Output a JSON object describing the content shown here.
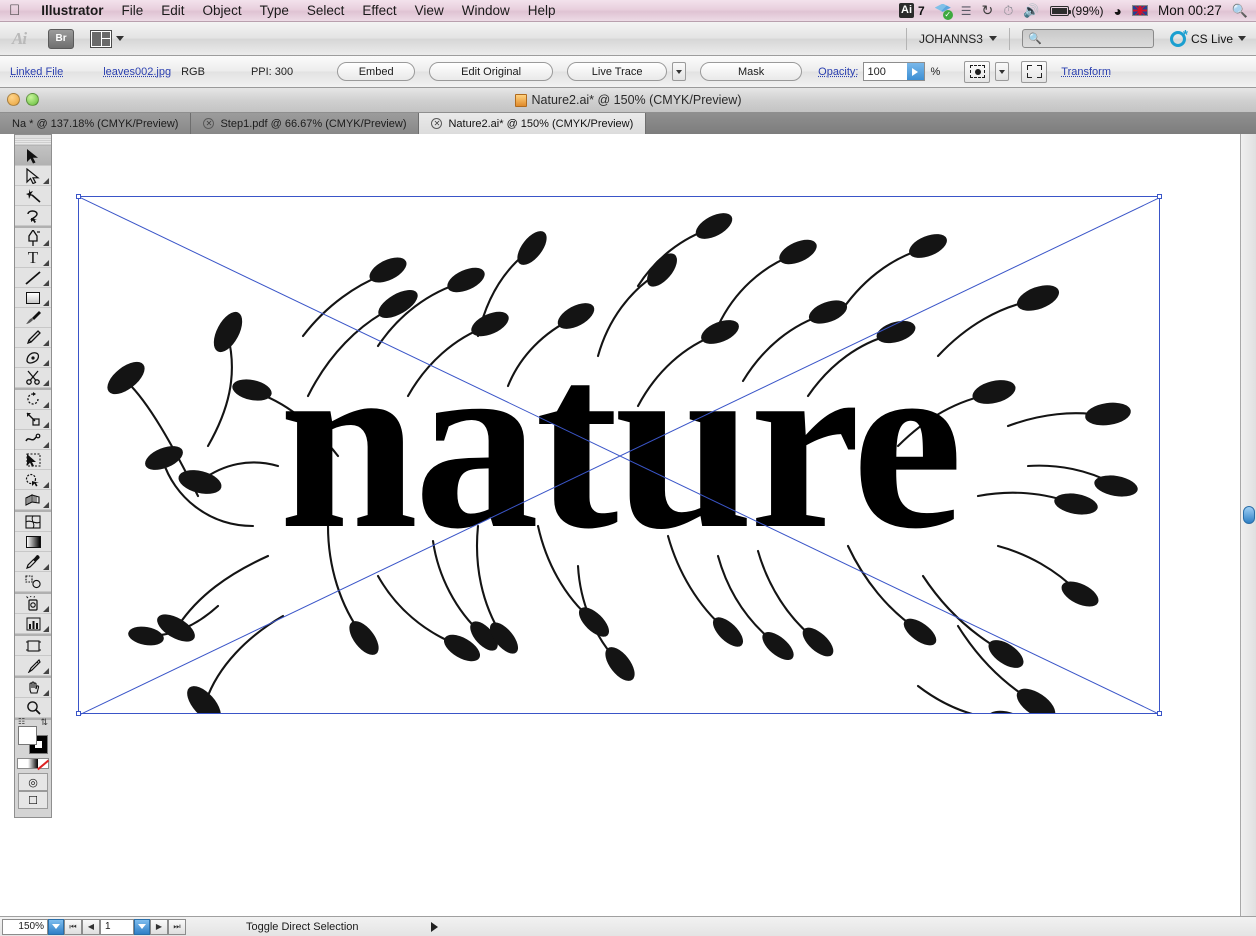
{
  "menubar": {
    "apple_icon": "apple-icon",
    "items": [
      "Illustrator",
      "File",
      "Edit",
      "Object",
      "Type",
      "Select",
      "Effect",
      "View",
      "Window",
      "Help"
    ],
    "status": {
      "adobe_count": "7",
      "adobe_glyph": "Ai",
      "battery_pct": "(99%)",
      "clock": "Mon 00:27",
      "icons": [
        "adobe-drive-icon",
        "dropbox-icon",
        "bluetooth-icon",
        "sync-icon",
        "time-machine-icon",
        "volume-icon",
        "battery-icon",
        "wifi-icon",
        "keyboard-flag-icon",
        "spotlight-search-icon"
      ]
    }
  },
  "appbar": {
    "logo": "Ai",
    "bridge_label": "Br",
    "arrange_label": "arrange-documents",
    "workspace": "JOHANNS3",
    "search_placeholder": "",
    "search_value": "",
    "cslive_label": "CS Live"
  },
  "controlbar": {
    "link_label": "Linked File",
    "file_name": "leaves002.jpg",
    "color_mode": "RGB",
    "ppi": "PPI: 300",
    "embed": "Embed",
    "edit_original": "Edit Original",
    "live_trace": "Live Trace",
    "mask": "Mask",
    "opacity_label": "Opacity:",
    "opacity_value": "100",
    "percent": "%",
    "transform": "Transform"
  },
  "window": {
    "title": "Nature2.ai* @ 150% (CMYK/Preview)"
  },
  "tabs": [
    {
      "label": "Na         * @ 137.18% (CMYK/Preview)",
      "active": false,
      "closable": false
    },
    {
      "label": "Step1.pdf @ 66.67% (CMYK/Preview)",
      "active": false,
      "closable": true
    },
    {
      "label": "Nature2.ai* @ 150% (CMYK/Preview)",
      "active": true,
      "closable": true
    }
  ],
  "tools": [
    {
      "name": "selection-tool",
      "glyph": "➤",
      "selected": true,
      "sub": false
    },
    {
      "name": "direct-selection-tool",
      "glyph": "➤",
      "selected": false,
      "sub": true
    },
    {
      "name": "magic-wand-tool",
      "glyph": "✦",
      "selected": false,
      "sub": false
    },
    {
      "name": "lasso-tool",
      "glyph": "◌",
      "selected": false,
      "sub": false
    },
    {
      "name": "pen-tool",
      "glyph": "✒",
      "selected": false,
      "sub": true
    },
    {
      "name": "type-tool",
      "glyph": "T",
      "selected": false,
      "sub": true
    },
    {
      "name": "line-segment-tool",
      "glyph": "╲",
      "selected": false,
      "sub": true
    },
    {
      "name": "rectangle-tool",
      "glyph": "▭",
      "selected": false,
      "sub": true
    },
    {
      "name": "paintbrush-tool",
      "glyph": "🖌",
      "selected": false,
      "sub": false
    },
    {
      "name": "pencil-tool",
      "glyph": "✎",
      "selected": false,
      "sub": true
    },
    {
      "name": "blob-brush-tool",
      "glyph": "◖",
      "selected": false,
      "sub": false
    },
    {
      "name": "eraser-scissors-tool",
      "glyph": "✂",
      "selected": false,
      "sub": true
    },
    {
      "name": "rotate-tool",
      "glyph": "↻",
      "selected": false,
      "sub": true
    },
    {
      "name": "scale-tool",
      "glyph": "⇲",
      "selected": false,
      "sub": true
    },
    {
      "name": "width-warp-tool",
      "glyph": "∿",
      "selected": false,
      "sub": true
    },
    {
      "name": "free-transform-tool",
      "glyph": "⬚",
      "selected": false,
      "sub": false
    },
    {
      "name": "shape-builder-tool",
      "glyph": "◍",
      "selected": false,
      "sub": true
    },
    {
      "name": "perspective-grid-tool",
      "glyph": "▤",
      "selected": false,
      "sub": true
    },
    {
      "name": "mesh-tool",
      "glyph": "▩",
      "selected": false,
      "sub": false
    },
    {
      "name": "gradient-tool",
      "glyph": "▬",
      "selected": false,
      "sub": false
    },
    {
      "name": "eyedropper-tool",
      "glyph": "⌖",
      "selected": false,
      "sub": true
    },
    {
      "name": "blend-tool",
      "glyph": "◌",
      "selected": false,
      "sub": false
    },
    {
      "name": "symbol-sprayer-tool",
      "glyph": "⛁",
      "selected": false,
      "sub": true
    },
    {
      "name": "column-graph-tool",
      "glyph": "▮",
      "selected": false,
      "sub": true
    },
    {
      "name": "artboard-tool",
      "glyph": "⬜",
      "selected": false,
      "sub": false
    },
    {
      "name": "slice-tool",
      "glyph": "✂",
      "selected": false,
      "sub": true
    },
    {
      "name": "hand-tool",
      "glyph": "✋",
      "selected": false,
      "sub": true
    },
    {
      "name": "zoom-tool",
      "glyph": "🔍",
      "selected": false,
      "sub": false
    }
  ],
  "toolpalette": {
    "fill_color": "#ffffff",
    "stroke_color": "#000000",
    "color_modes": [
      "color-swatch",
      "gradient-swatch",
      "none-swatch"
    ],
    "screen_modes": [
      "draw-normal-mode",
      "change-screen-mode"
    ]
  },
  "canvas": {
    "artwork_title": "nature",
    "artwork_description": "Bold serif wordmark 'nature' surrounded by hand-drawn vine and leaf illustrations",
    "selection_color": "#3a55c8"
  },
  "statusbar": {
    "zoom_value": "150%",
    "page_value": "1",
    "status_text": "Toggle Direct Selection"
  }
}
